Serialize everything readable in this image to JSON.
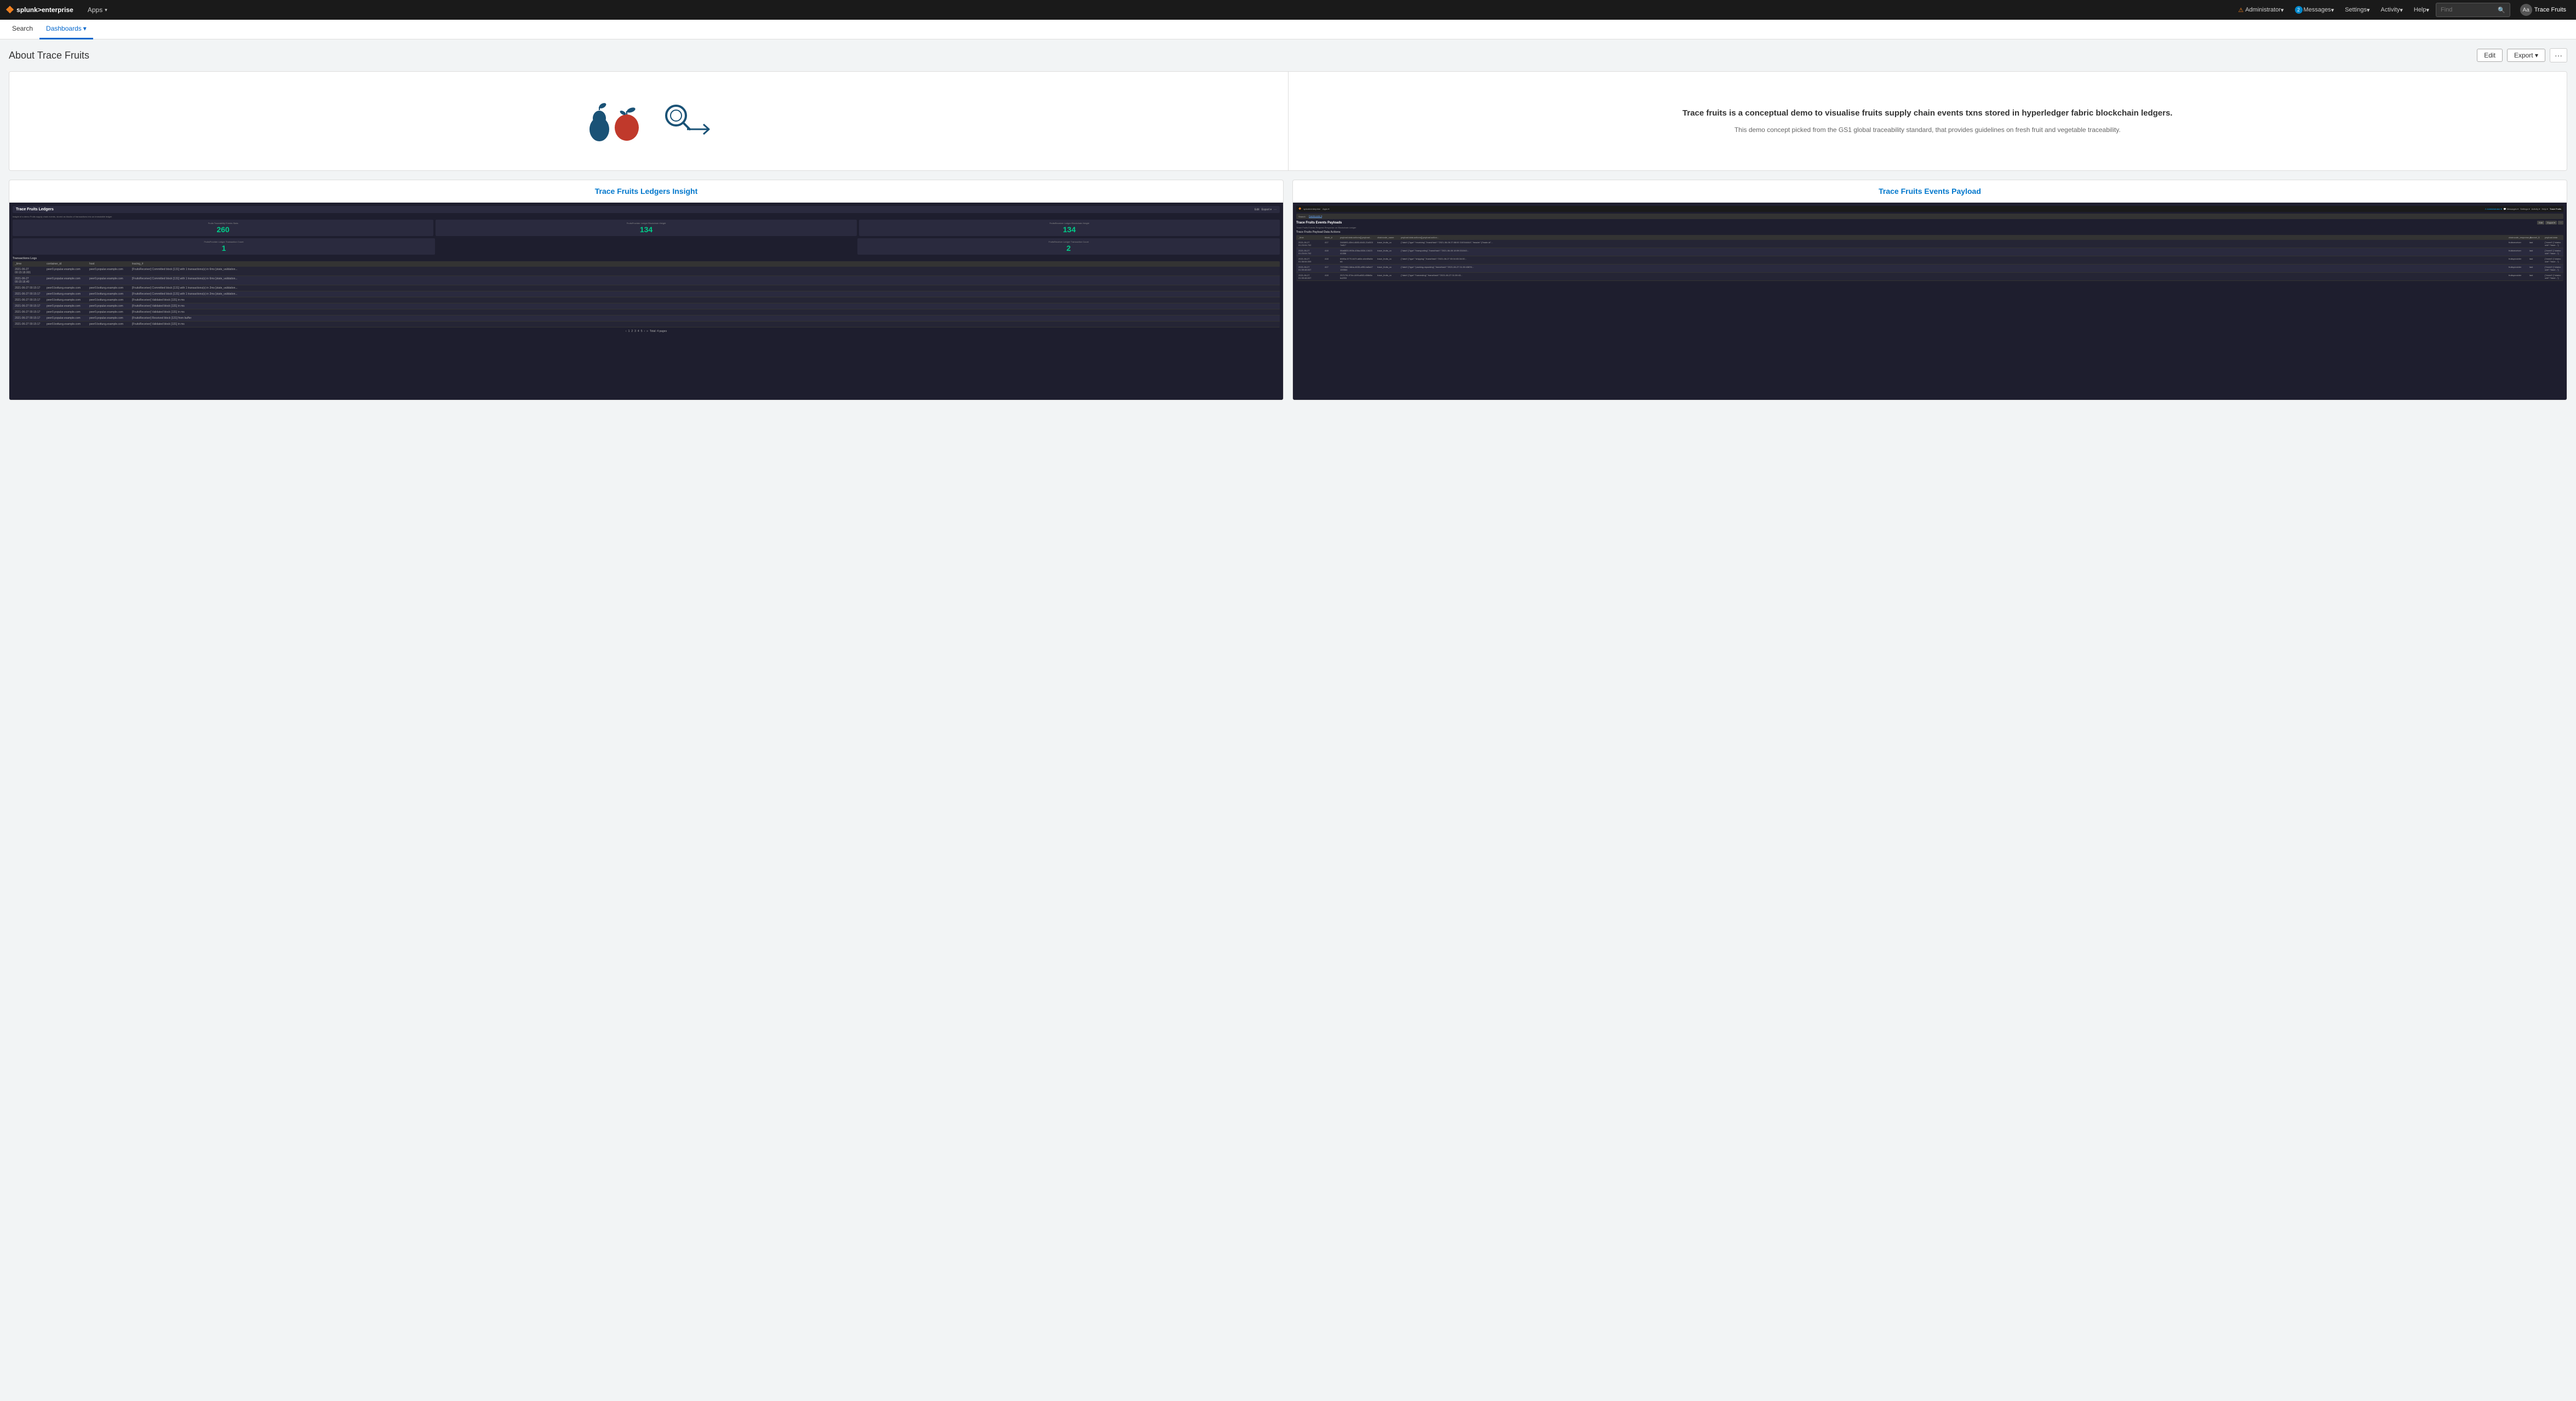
{
  "topNav": {
    "logo": {
      "icon": "❖",
      "text": "splunk>enterprise"
    },
    "items": [
      {
        "label": "Apps",
        "hasDropdown": true
      },
      {
        "label": "Activity",
        "hasDropdown": true
      }
    ],
    "right": [
      {
        "label": "Administrator",
        "hasDropdown": true,
        "hasAlert": true
      },
      {
        "label": "Messages",
        "hasDropdown": true,
        "badgeCount": "2"
      },
      {
        "label": "Settings",
        "hasDropdown": true
      },
      {
        "label": "Activity",
        "hasDropdown": true
      },
      {
        "label": "Help",
        "hasDropdown": true
      }
    ],
    "search": {
      "placeholder": "Find",
      "button_label": "🔍"
    },
    "user": {
      "avatar": "Aa",
      "name": "Trace Fruits"
    }
  },
  "secondNav": {
    "items": [
      {
        "label": "Search",
        "active": false
      },
      {
        "label": "Dashboards",
        "active": true,
        "hasDropdown": true
      }
    ]
  },
  "page": {
    "title": "About Trace Fruits",
    "actions": {
      "edit_label": "Edit",
      "export_label": "Export",
      "more_label": "···"
    }
  },
  "hero": {
    "description": "Trace fruits is a conceptual demo to visualise fruits supply chain events txns stored in hyperledger fabric blockchain ledgers.",
    "subtitle": "This demo concept picked from the GS1 global traceability standard, that provides guidelines on fresh fruit and vegetable traceability."
  },
  "cards": [
    {
      "title": "Trace Fruits Ledgers Insight",
      "metrics": [
        {
          "label": "Fruits Traceability Events Stats",
          "value": "260"
        },
        {
          "label": "FruitsProvider Ledger Blockchain Height",
          "value": "134"
        },
        {
          "label": "FruitsReceiver Ledger Blockchain Height",
          "value": "134"
        }
      ],
      "transactionMetrics": [
        {
          "label": "FruitsProvider Ledger Transaction Count",
          "value": "1"
        },
        {
          "label": "FruitsReceiver Ledger Transaction Count",
          "value": "2"
        }
      ],
      "tableTitle": "Transactions Logs",
      "tableHeaders": [
        "_time",
        "container_id",
        "host",
        "tracing_#"
      ],
      "tableRows": [
        {
          "time": "2021-06-27 00:15:18.001",
          "container": "peer0.popular.example.com 5f7563365",
          "host": "peer0.popular.example.com",
          "tracing": "[FruitsReceiver] Committed block [131] with 1 transactions(s) in 6ms [state_validation..."
        },
        {
          "time": "2021-06-27 00:15:18.40",
          "container": "peer0.popular.example.com",
          "host": "peer0.popular.example.com",
          "tracing": "[FruitsReceiver] Committed block [131] with 1 transactions(s) in 6ms [state_validation..."
        },
        {
          "time": "2021-06-27 00:15:17",
          "container": "peer0.bottung.example.com",
          "host": "peer0.bottung.example.com",
          "tracing": "[FruitsReceiver] Committed block [131] with 1 transactions(s) in 2ms [state_validation..."
        },
        {
          "time": "2021-06-27 00:15:17",
          "container": "peer0.bottung.example.com",
          "host": "peer0.bottung.example.com",
          "tracing": "[FruitsReceiver] Committed block [131] with 1 transactions(s) in 2ms [state_validation..."
        },
        {
          "time": "2021-06-27 00:15:17",
          "container": "peer0.bottung.example.com",
          "host": "peer0.bottung.example.com",
          "tracing": "[FruitsReceiver] Validated block [131] in ms"
        },
        {
          "time": "2021-06-27 00:15:17",
          "container": "peer0.popular.example.com",
          "host": "peer0.popular.example.com",
          "tracing": "[FruitsReceiver] Validated block [131] in ms"
        },
        {
          "time": "2021-06-27 00:15:17",
          "container": "peer0.popular.example.com",
          "host": "peer0.popular.example.com",
          "tracing": "[FruitsReceiver] Validated block [131] in ms"
        },
        {
          "time": "2021-06-27 00:15:17",
          "container": "peer0.popular.example.com",
          "host": "peer0.popular.example.com",
          "tracing": "[FruitsReceiver] Received block [131] from buffer"
        },
        {
          "time": "2021-06-27 00:15:17",
          "container": "peer0.bottung.example.com",
          "host": "peer0.bottung.example.com",
          "tracing": "[FruitsReceiver] Validated block [131] in ms"
        }
      ]
    },
    {
      "title": "Trace Fruits Events Payload",
      "innerTitle": "Trace Fruits Events Payloads",
      "innerSubtitle": "Trace Fruits Events Request Response on Blockchain Ledger",
      "tableTitle": "Trace Fruits Payload Data Actions",
      "tableHeaders": [
        "_time",
        "block_number",
        "payload.data.actions[].payload.action.proposal_response_payload.extension.results.ns_rwset[].rwset.writes[].value",
        "chaincode_name",
        "payload.data.actions[].payload.action.proposal_response_payload.extension.results.ns_rwset[].rwset.writes[].value",
        "chaincode_response_$",
        "channel_$",
        "payload.data"
      ],
      "tableRows": [
        {
          "time": "2021-06-27 01:23:04.702",
          "block": "417",
          "key": "24f4693-43b4-4683-4643-21d3037a617",
          "chaincode": "trace_fruits_cc",
          "payload": "{\"data\":{\"type\":\"receiving\",\"transHash\":\"2021-06-06 27:88:00 310344444\",\"header\":{\"trade-id\"...",
          "response": "fruitsreceiver",
          "last_channel": "last",
          "data": "{\"event\":{\"chaincode\":\"trace...\"}"
        },
        {
          "time": "2021-06-27 01:23:04.702",
          "block": "418",
          "key": "06a6833-993b-436a-6534-1342341356",
          "chaincode": "trace_fruits_cc",
          "payload": "{\"data\":{\"type\":\"transporting\",\"transHash\":\"2021-06-06 18:59:331543...",
          "response": "fruitsreceiver",
          "last_channel": "last",
          "data": "{\"event\":{\"chaincode\":\"trace...\"}"
        },
        {
          "time": "2021-06-27 01:36:54.009",
          "block": "418",
          "key": "6f4f0a-5770-647f-a66e-d4e69a5eb6",
          "chaincode": "trace_fruits_cc",
          "payload": "{\"data\":{\"type\":\"shipping\",\"transHash\":\"2021-06-27 00:04 83:34:00...",
          "response": "fruitsprovider",
          "last_channel": "last",
          "data": "{\"event\":{\"chaincode\":\"trace...\"}"
        },
        {
          "time": "2021-06-27 01:39:48.537",
          "block": "417",
          "key": "7370384-3dba-4635-af95-ba5a47100564",
          "chaincode": "trace_fruits_cc",
          "payload": "{\"data\":{\"type\":\"packing-repacking\",\"transHash\":\"2021-06-27 01:39:43876...",
          "response": "fruitsprovider",
          "last_channel": "last",
          "data": "{\"event\":{\"chaincode\":\"trace...\"}"
        },
        {
          "time": "2021-06-27 01:39:48.537",
          "block": "418",
          "key": "25717f4-974e-449f-a863-d06b8abd2f33",
          "chaincode": "trace_fruits_cc",
          "payload": "{\"data\":{\"type\":\"harvesting\",\"transHash\":\"2021-06-27 01:39:43...",
          "response": "fruitsprovider",
          "last_channel": "last",
          "data": "{\"event\":{\"chaincode\":\"trace...\"}"
        }
      ]
    }
  ]
}
